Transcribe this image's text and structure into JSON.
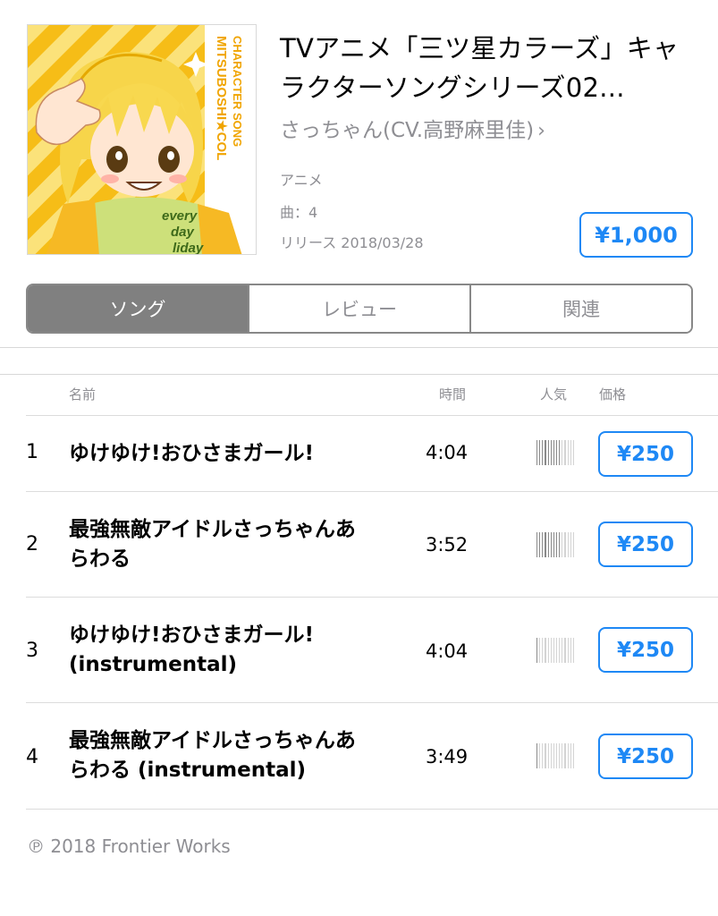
{
  "album": {
    "title": "TVアニメ「三ツ星カラーズ」キャラクターソングシリーズ02...",
    "artist": "さっちゃん(CV.高野麻里佳)",
    "artist_chevron": "›",
    "genre": "アニメ",
    "track_count": "曲：4",
    "release": "リリース 2018/03/28",
    "price": "¥1,000",
    "artwork_text": {
      "side_line1": "MITSUBOSHI★COL",
      "side_line2": "CHARACTER SONG",
      "shirt_line1": "every",
      "shirt_line2": "day",
      "shirt_line3": "liday"
    }
  },
  "tabs": [
    {
      "label": "ソング",
      "active": true
    },
    {
      "label": "レビュー",
      "active": false
    },
    {
      "label": "関連",
      "active": false
    }
  ],
  "table": {
    "headers": {
      "name": "名前",
      "time": "時間",
      "popularity": "人気",
      "price": "価格"
    },
    "tracks": [
      {
        "number": "1",
        "name": "ゆけゆけ!おひさまガール!",
        "time": "4:04",
        "popularity": 0.65,
        "price": "¥250"
      },
      {
        "number": "2",
        "name": "最強無敵アイドルさっちゃんあらわる",
        "time": "3:52",
        "popularity": 0.65,
        "price": "¥250"
      },
      {
        "number": "3",
        "name": "ゆけゆけ!おひさまガール! (instrumental)",
        "time": "4:04",
        "popularity": 0.1,
        "price": "¥250"
      },
      {
        "number": "4",
        "name": "最強無敵アイドルさっちゃんあらわる (instrumental)",
        "time": "3:49",
        "popularity": 0.1,
        "price": "¥250"
      }
    ]
  },
  "copyright": "℗ 2018 Frontier Works",
  "colors": {
    "accent": "#1e88f5",
    "secondary_text": "#8e8e93",
    "active_tab": "#808080"
  }
}
